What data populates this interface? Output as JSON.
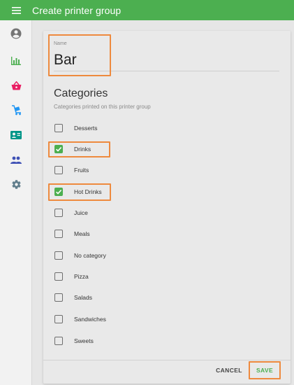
{
  "appbar": {
    "title": "Create printer group",
    "menu_icon": "hamburger-menu-icon"
  },
  "sidebar": {
    "items": [
      {
        "icon": "account-circle-icon",
        "color": "#757575"
      },
      {
        "icon": "bar-chart-icon",
        "color": "#4caf50"
      },
      {
        "icon": "shopping-basket-icon",
        "color": "#e91e63"
      },
      {
        "icon": "delivery-cart-icon",
        "color": "#2196f3"
      },
      {
        "icon": "contact-card-icon",
        "color": "#009688"
      },
      {
        "icon": "people-icon",
        "color": "#3f51b5"
      },
      {
        "icon": "settings-gear-icon",
        "color": "#607d8b"
      }
    ]
  },
  "form": {
    "name_label": "Name",
    "name_value": "Bar",
    "categories_title": "Categories",
    "categories_subtitle": "Categories printed on this printer group",
    "categories": [
      {
        "label": "Desserts",
        "checked": false
      },
      {
        "label": "Drinks",
        "checked": true
      },
      {
        "label": "Fruits",
        "checked": false
      },
      {
        "label": "Hot Drinks",
        "checked": true
      },
      {
        "label": "Juice",
        "checked": false
      },
      {
        "label": "Meals",
        "checked": false
      },
      {
        "label": "No category",
        "checked": false
      },
      {
        "label": "Pizza",
        "checked": false
      },
      {
        "label": "Salads",
        "checked": false
      },
      {
        "label": "Sandwiches",
        "checked": false
      },
      {
        "label": "Sweets",
        "checked": false
      }
    ]
  },
  "actions": {
    "cancel_label": "CANCEL",
    "save_label": "SAVE"
  },
  "colors": {
    "primary": "#4caf50",
    "highlight": "#ee8a3e"
  }
}
